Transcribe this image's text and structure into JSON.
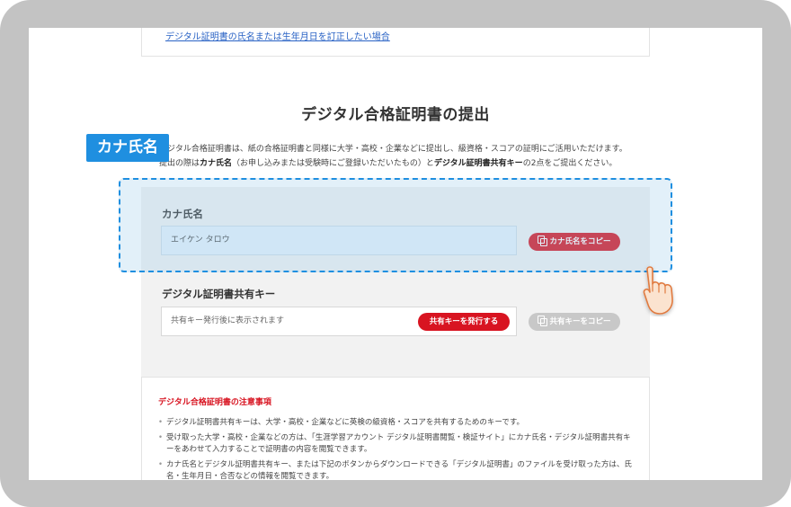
{
  "top_link": "デジタル証明書の氏名または生年月日を訂正したい場合",
  "section_title": "デジタル合格証明書の提出",
  "intro": {
    "line1": "デジタル合格証明書は、紙の合格証明書と同様に大学・高校・企業などに提出し、級資格・スコアの証明にご活用いただけます。",
    "line2_a": "提出の際は",
    "line2_b": "カナ氏名",
    "line2_c": "（お申し込みまたは受験時にご登録いただいたもの）と",
    "line2_d": "デジタル証明書共有キー",
    "line2_e": "の2点をご提出ください。"
  },
  "tag_label": "カナ氏名",
  "kana_field": {
    "label": "カナ氏名",
    "value": "エイケン タロウ",
    "copy_button": "カナ氏名をコピー"
  },
  "key_field": {
    "label": "デジタル証明書共有キー",
    "placeholder": "共有キー発行後に表示されます",
    "issue_button": "共有キーを発行する",
    "copy_button": "共有キーをコピー"
  },
  "notes": {
    "title": "デジタル合格証明書の注意事項",
    "items": [
      "デジタル証明書共有キーは、大学・高校・企業などに英検の級資格・スコアを共有するためのキーです。",
      "受け取った大学・高校・企業などの方は、「生涯学習アカウント デジタル証明書閲覧・検証サイト」にカナ氏名・デジタル証明書共有キーをあわせて入力することで証明書の内容を閲覧できます。",
      "カナ氏名とデジタル証明書共有キー、または下記のボタンからダウンロードできる「デジタル証明書」のファイルを受け取った方は、氏名・生年月日・合否などの情報を閲覧できます。"
    ]
  },
  "colors": {
    "accent_red": "#d81421",
    "highlight_blue": "#1f8fe0",
    "frame_grey": "#c3c3c3"
  }
}
